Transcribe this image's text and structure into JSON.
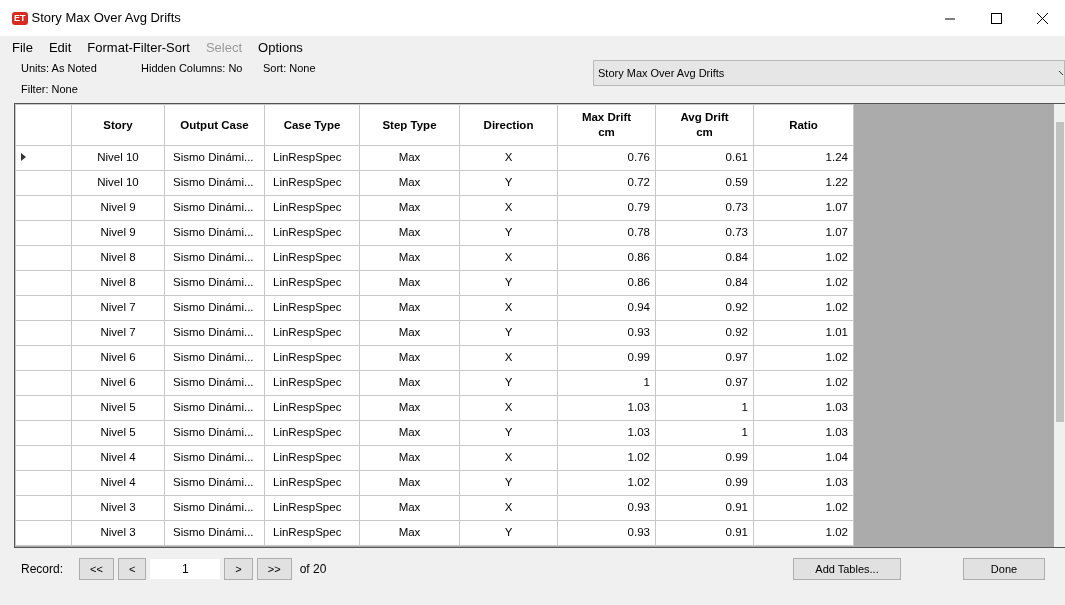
{
  "window": {
    "title": "Story Max Over Avg Drifts",
    "logo": "ET"
  },
  "menu": [
    {
      "label": "File",
      "disabled": false
    },
    {
      "label": "Edit",
      "disabled": false
    },
    {
      "label": "Format-Filter-Sort",
      "disabled": false
    },
    {
      "label": "Select",
      "disabled": true
    },
    {
      "label": "Options",
      "disabled": false
    }
  ],
  "info": {
    "units": "Units: As Noted",
    "hidden_columns": "Hidden Columns: No",
    "sort": "Sort: None",
    "filter": "Filter: None"
  },
  "table_select": {
    "value": "Story Max Over Avg Drifts"
  },
  "table": {
    "columns": [
      {
        "label": "Story"
      },
      {
        "label": "Output Case"
      },
      {
        "label": "Case Type"
      },
      {
        "label": "Step Type"
      },
      {
        "label": "Direction"
      },
      {
        "label": "Max Drift",
        "unit": "cm"
      },
      {
        "label": "Avg Drift",
        "unit": "cm"
      },
      {
        "label": "Ratio"
      }
    ],
    "rows": [
      {
        "current": true,
        "cells": [
          "Nivel 10",
          "Sismo Dinámi...",
          "LinRespSpec",
          "Max",
          "X",
          "0.76",
          "0.61",
          "1.24"
        ]
      },
      {
        "current": false,
        "cells": [
          "Nivel 10",
          "Sismo Dinámi...",
          "LinRespSpec",
          "Max",
          "Y",
          "0.72",
          "0.59",
          "1.22"
        ]
      },
      {
        "current": false,
        "cells": [
          "Nivel 9",
          "Sismo Dinámi...",
          "LinRespSpec",
          "Max",
          "X",
          "0.79",
          "0.73",
          "1.07"
        ]
      },
      {
        "current": false,
        "cells": [
          "Nivel 9",
          "Sismo Dinámi...",
          "LinRespSpec",
          "Max",
          "Y",
          "0.78",
          "0.73",
          "1.07"
        ]
      },
      {
        "current": false,
        "cells": [
          "Nivel 8",
          "Sismo Dinámi...",
          "LinRespSpec",
          "Max",
          "X",
          "0.86",
          "0.84",
          "1.02"
        ]
      },
      {
        "current": false,
        "cells": [
          "Nivel 8",
          "Sismo Dinámi...",
          "LinRespSpec",
          "Max",
          "Y",
          "0.86",
          "0.84",
          "1.02"
        ]
      },
      {
        "current": false,
        "cells": [
          "Nivel 7",
          "Sismo Dinámi...",
          "LinRespSpec",
          "Max",
          "X",
          "0.94",
          "0.92",
          "1.02"
        ]
      },
      {
        "current": false,
        "cells": [
          "Nivel 7",
          "Sismo Dinámi...",
          "LinRespSpec",
          "Max",
          "Y",
          "0.93",
          "0.92",
          "1.01"
        ]
      },
      {
        "current": false,
        "cells": [
          "Nivel 6",
          "Sismo Dinámi...",
          "LinRespSpec",
          "Max",
          "X",
          "0.99",
          "0.97",
          "1.02"
        ]
      },
      {
        "current": false,
        "cells": [
          "Nivel 6",
          "Sismo Dinámi...",
          "LinRespSpec",
          "Max",
          "Y",
          "1",
          "0.97",
          "1.02"
        ]
      },
      {
        "current": false,
        "cells": [
          "Nivel 5",
          "Sismo Dinámi...",
          "LinRespSpec",
          "Max",
          "X",
          "1.03",
          "1",
          "1.03"
        ]
      },
      {
        "current": false,
        "cells": [
          "Nivel 5",
          "Sismo Dinámi...",
          "LinRespSpec",
          "Max",
          "Y",
          "1.03",
          "1",
          "1.03"
        ]
      },
      {
        "current": false,
        "cells": [
          "Nivel 4",
          "Sismo Dinámi...",
          "LinRespSpec",
          "Max",
          "X",
          "1.02",
          "0.99",
          "1.04"
        ]
      },
      {
        "current": false,
        "cells": [
          "Nivel 4",
          "Sismo Dinámi...",
          "LinRespSpec",
          "Max",
          "Y",
          "1.02",
          "0.99",
          "1.03"
        ]
      },
      {
        "current": false,
        "cells": [
          "Nivel 3",
          "Sismo Dinámi...",
          "LinRespSpec",
          "Max",
          "X",
          "0.93",
          "0.91",
          "1.02"
        ]
      },
      {
        "current": false,
        "cells": [
          "Nivel 3",
          "Sismo Dinámi...",
          "LinRespSpec",
          "Max",
          "Y",
          "0.93",
          "0.91",
          "1.02"
        ]
      }
    ]
  },
  "footer": {
    "record_label": "Record:",
    "first": "<<",
    "prev": "<",
    "record": "1",
    "next": ">",
    "last": ">>",
    "of": "of 20",
    "add_tables": "Add Tables...",
    "done": "Done"
  }
}
